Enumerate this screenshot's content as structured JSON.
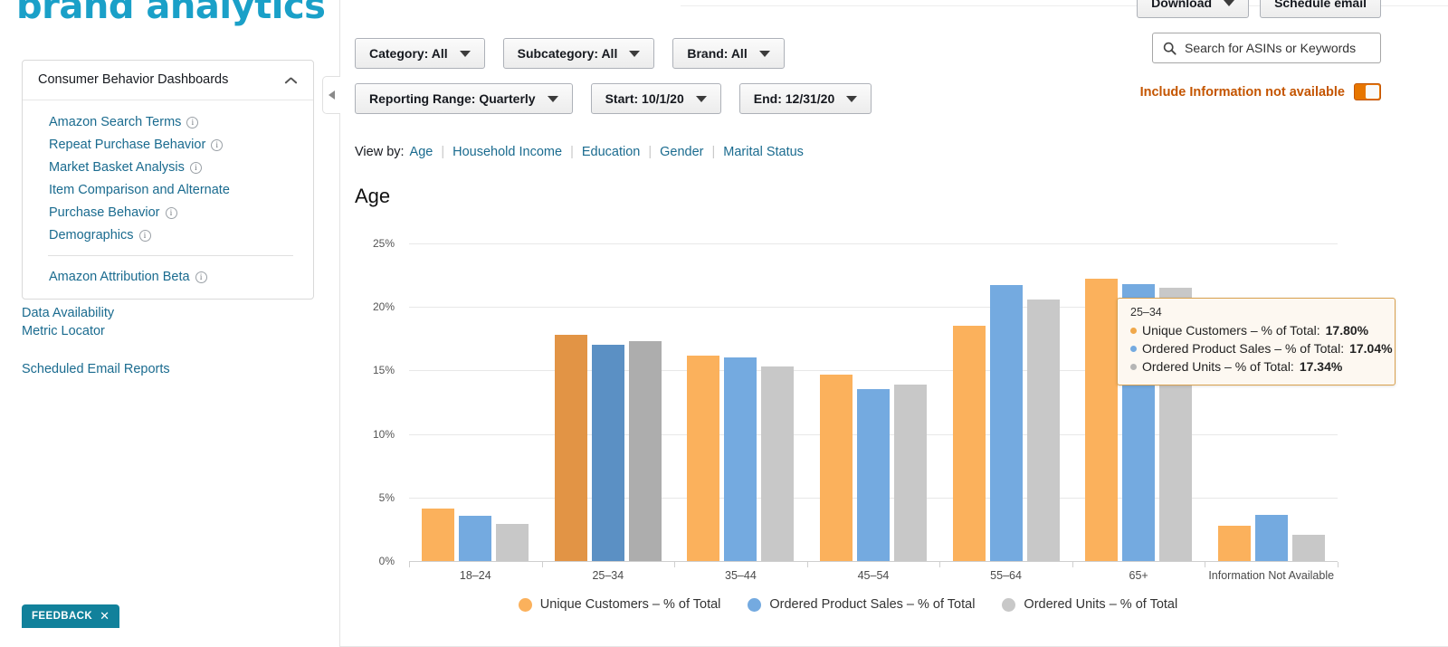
{
  "brand": {
    "logo_text": "brand analytics"
  },
  "sidebar": {
    "card_title": "Consumer Behavior Dashboards",
    "collapse_icon": "chevron-up-icon",
    "items": [
      {
        "label": "Amazon Search Terms",
        "info": true
      },
      {
        "label": "Repeat Purchase Behavior",
        "info": true
      },
      {
        "label": "Market Basket Analysis",
        "info": true
      },
      {
        "label": "Item Comparison and Alternate",
        "info": false
      },
      {
        "label": "Purchase Behavior",
        "info": true
      },
      {
        "label": "Demographics",
        "info": true
      }
    ],
    "items_after_sep": [
      {
        "label": "Amazon Attribution Beta",
        "info": true
      }
    ],
    "links": [
      "Data Availability",
      "Metric Locator"
    ],
    "links_2": [
      "Scheduled Email Reports"
    ],
    "handle_icon": "triangle-left-icon"
  },
  "feedback": {
    "label": "FEEDBACK",
    "close_icon": "close-icon"
  },
  "toolbar": {
    "download_label": "Download",
    "schedule_email_label": "Schedule email",
    "filters_row1": [
      {
        "label": "Category: All"
      },
      {
        "label": "Subcategory: All"
      },
      {
        "label": "Brand: All"
      }
    ],
    "filters_row2": [
      {
        "label": "Reporting Range: Quarterly"
      },
      {
        "label": "Start: 10/1/20"
      },
      {
        "label": "End: 12/31/20"
      }
    ]
  },
  "search": {
    "placeholder": "Search for ASINs or Keywords",
    "value": "",
    "icon": "search-icon"
  },
  "toggle": {
    "label": "Include Information not available",
    "state": "on",
    "color": "#e77600"
  },
  "view_by": {
    "label": "View by:",
    "options": [
      "Age",
      "Household Income",
      "Education",
      "Gender",
      "Marital Status"
    ],
    "selected": "Age",
    "divider": "|"
  },
  "tooltip": {
    "category": "25–34",
    "rows": [
      {
        "name": "Unique Customers – % of Total:",
        "value": "17.80%",
        "color": "#f0a84b"
      },
      {
        "name": "Ordered Product Sales – % of Total:",
        "value": "17.04%",
        "color": "#74aae0"
      },
      {
        "name": "Ordered Units – % of Total:",
        "value": "17.34%",
        "color": "#b5b5b5"
      }
    ]
  },
  "chart_data": {
    "type": "bar",
    "title": "Age",
    "xlabel": "",
    "ylabel": "",
    "ylim": [
      0,
      25
    ],
    "yticks": [
      "0%",
      "5%",
      "10%",
      "15%",
      "20%",
      "25%"
    ],
    "ytick_values": [
      0,
      5,
      10,
      15,
      20,
      25
    ],
    "grid": true,
    "legend_position": "bottom",
    "highlighted_category": "25–34",
    "categories": [
      "18–24",
      "25–34",
      "35–44",
      "45–54",
      "55–64",
      "65+",
      "Information Not Available"
    ],
    "series": [
      {
        "name": "Unique Customers – % of Total",
        "color": "#fbb15c",
        "values": [
          4.15,
          17.8,
          16.2,
          14.7,
          18.5,
          22.2,
          2.8
        ]
      },
      {
        "name": "Ordered Product Sales – % of Total",
        "color": "#74aae0",
        "values": [
          3.55,
          17.04,
          16.0,
          13.5,
          21.7,
          21.8,
          3.6
        ]
      },
      {
        "name": "Ordered Units – % of Total",
        "color": "#c8c8c8",
        "values": [
          2.95,
          17.34,
          15.3,
          13.9,
          20.6,
          21.5,
          2.05
        ]
      }
    ]
  }
}
